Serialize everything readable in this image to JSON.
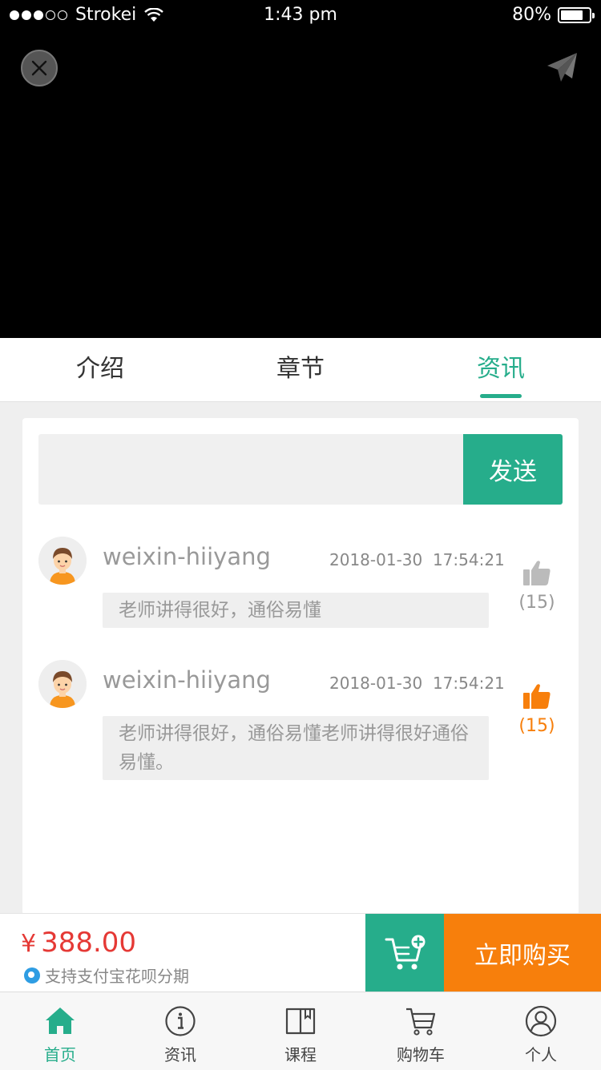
{
  "status_bar": {
    "carrier": "Strokei",
    "time": "1:43 pm",
    "battery": "80%"
  },
  "tabs": [
    {
      "label": "介绍",
      "active": false
    },
    {
      "label": "章节",
      "active": false
    },
    {
      "label": "资讯",
      "active": true
    }
  ],
  "comment_box": {
    "placeholder": "",
    "send_label": "发送"
  },
  "comments": [
    {
      "user": "weixin-hiiyang",
      "date": "2018-01-30",
      "time": "17:54:21",
      "text": "老师讲得很好，通俗易懂",
      "likes": "(15)",
      "liked": false
    },
    {
      "user": "weixin-hiiyang",
      "date": "2018-01-30",
      "time": "17:54:21",
      "text": "老师讲得很好，通俗易懂老师讲得很好通俗易懂。",
      "likes": "(15)",
      "liked": true
    }
  ],
  "purchase": {
    "currency": "¥",
    "price": "388.00",
    "installment": "支持支付宝花呗分期",
    "buy_label": "立即购买"
  },
  "bottom_nav": [
    {
      "label": "首页",
      "icon": "home-icon",
      "active": true
    },
    {
      "label": "资讯",
      "icon": "info-icon",
      "active": false
    },
    {
      "label": "课程",
      "icon": "book-icon",
      "active": false
    },
    {
      "label": "购物车",
      "icon": "cart-icon",
      "active": false
    },
    {
      "label": "个人",
      "icon": "user-icon",
      "active": false
    }
  ],
  "colors": {
    "accent": "#26ad8b",
    "buy": "#f77f0c",
    "price": "#e53935"
  }
}
